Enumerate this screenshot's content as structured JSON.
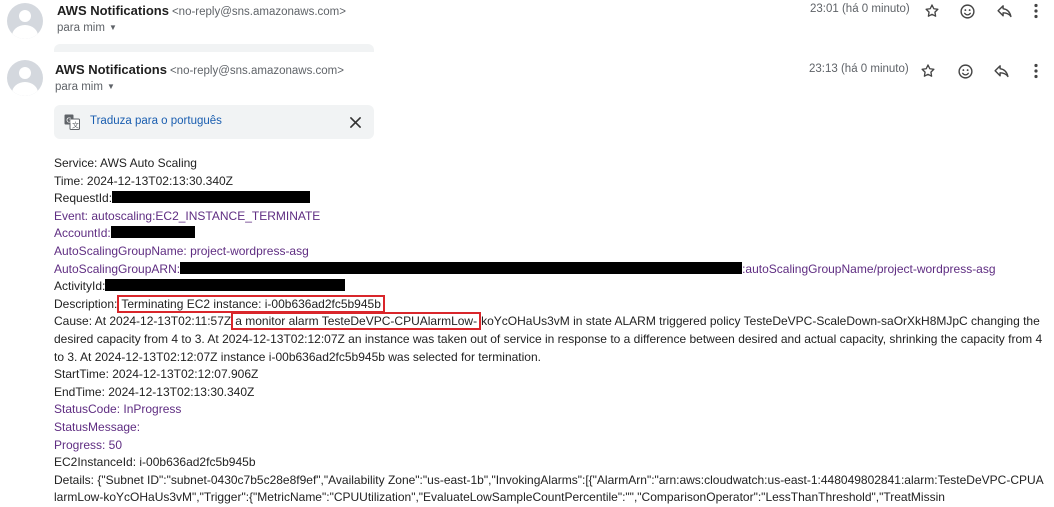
{
  "message1": {
    "sender": "AWS Notifications",
    "address": "<no-reply@sns.amazonaws.com>",
    "recipient": "para mim",
    "time": "23:01 (há 0 minuto)"
  },
  "message2": {
    "sender": "AWS Notifications",
    "address": "<no-reply@sns.amazonaws.com>",
    "recipient": "para mim",
    "time": "23:13 (há 0 minuto)"
  },
  "translate_bar": {
    "link": "Traduza para o português"
  },
  "email_body": {
    "service": "Service: AWS Auto Scaling",
    "time": "Time: 2024-12-13T02:13:30.340Z",
    "request_id_label": "RequestId:",
    "event": "Event: autoscaling:EC2_INSTANCE_TERMINATE",
    "account_id_label": "AccountId:",
    "asg_name": "AutoScalingGroupName: project-wordpress-asg",
    "asg_arn_label": "AutoScalingGroupARN:",
    "asg_arn_suffix": ":autoScalingGroupName/project-wordpress-asg",
    "activity_id_label": "ActivityId:",
    "description_label": "Description:",
    "description_value": "Terminating EC2 instance: i-00b636ad2fc5b945b",
    "cause_prefix": "Cause: At 2024-12-13T02:11:57Z",
    "cause_highlight": "a monitor alarm TesteDeVPC-CPUAlarmLow-",
    "cause_rest": "koYcOHaUs3vM in state ALARM triggered policy TesteDeVPC-ScaleDown-saOrXkH8MJpC changing the desired capacity from 4 to 3.  At 2024-12-13T02:12:07Z an instance was taken out of service in response to a difference between desired and actual capacity, shrinking the capacity from 4 to 3.  At 2024-12-13T02:12:07Z instance i-00b636ad2fc5b945b was selected for termination.",
    "start_time": "StartTime: 2024-12-13T02:12:07.906Z",
    "end_time": "EndTime: 2024-12-13T02:13:30.340Z",
    "status_code": "StatusCode: InProgress",
    "status_message": "StatusMessage:",
    "progress": "Progress: 50",
    "ec2_instance_id": "EC2InstanceId: i-00b636ad2fc5b945b",
    "details": "Details: {\"Subnet ID\":\"subnet-0430c7b5c28e8f9ef\",\"Availability Zone\":\"us-east-1b\",\"InvokingAlarms\":[{\"AlarmArn\":\"arn:aws:cloudwatch:us-east-1:448049802841:alarm:TesteDeVPC-CPUAlarmLow-koYcOHaUs3vM\",\"Trigger\":{\"MetricName\":\"CPUUtilization\",\"EvaluateLowSampleCountPercentile\":\"\",\"ComparisonOperator\":\"LessThanThreshold\",\"TreatMissin"
  },
  "colors": {
    "link_blue": "#1a5eb0",
    "purple_text": "#5f2d82",
    "highlight_red": "#d9262b",
    "redaction": "#000000"
  },
  "icons": [
    "person-avatar-icon",
    "star-icon",
    "emoji-icon",
    "reply-icon",
    "more-vert-icon",
    "translate-icon",
    "close-icon",
    "chevron-down-icon"
  ]
}
